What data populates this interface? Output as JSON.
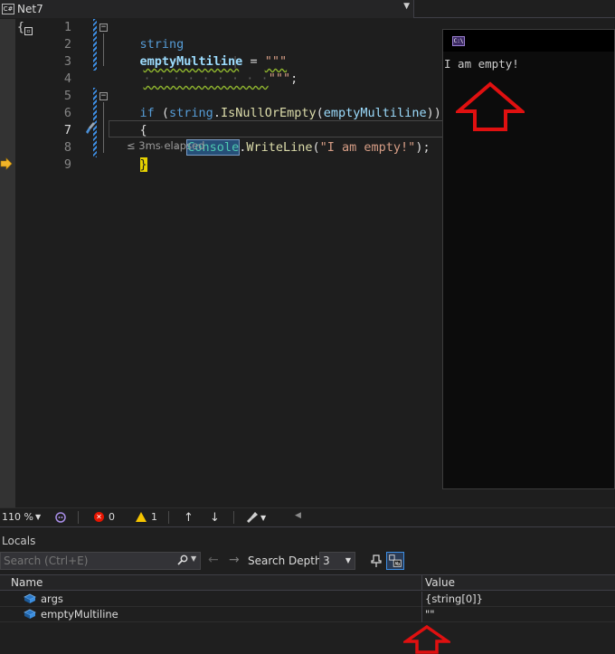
{
  "topbar": {
    "project_name": "Net7",
    "project_icon": "C#"
  },
  "editor": {
    "line_numbers": [
      "1",
      "2",
      "3",
      "4",
      "5",
      "6",
      "7",
      "8",
      "9"
    ],
    "active_line": "7",
    "line1": {
      "kw": "string",
      "var": "emptyMultiline",
      "op": " = ",
      "str": "\"\"\""
    },
    "line2": {
      "dots": "· · · · · · |"
    },
    "line3": {
      "dots": "· · · · · · · · ·",
      "str": "\"\"\"",
      "semi": ";"
    },
    "line5": {
      "kw": "if",
      "open": " (",
      "type": "string",
      "dot": ".",
      "meth": "IsNullOrEmpty",
      "paren_open": "(",
      "var": "emptyMultiline",
      "close": "))"
    },
    "line6": {
      "brace": "{"
    },
    "line7": {
      "dots": "· · · ",
      "type": "Console",
      "dot": ".",
      "meth": "WriteLine",
      "paren_open": "(",
      "str": "\"I am empty!\"",
      "close": ");"
    },
    "line8": {
      "brace": "}"
    },
    "elapsed": "≤ 3ms elapsed"
  },
  "console": {
    "icon": "C:\\",
    "output": "I am empty!"
  },
  "statusbar": {
    "zoom": "110 %",
    "errors": "0",
    "warnings": "1"
  },
  "locals": {
    "title": "Locals",
    "search_placeholder": "Search (Ctrl+E)",
    "depth_label": "Search Depth:",
    "depth_value": "3",
    "columns": {
      "name": "Name",
      "value": "Value"
    },
    "rows": [
      {
        "name": "args",
        "value": "{string[0]}"
      },
      {
        "name": "emptyMultiline",
        "value": "\"\""
      }
    ]
  },
  "colors": {
    "accent_blue": "#3d8ee4",
    "annotation_red": "#e01010",
    "warning_yellow": "#f5c400",
    "error_red": "#e51400"
  }
}
